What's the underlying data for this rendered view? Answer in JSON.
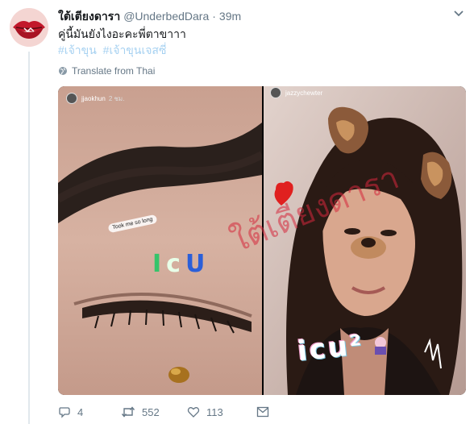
{
  "tweet": {
    "display_name": "ใต้เตียงดารา",
    "handle": "@UnderbedDara",
    "separator": "·",
    "time": "39m",
    "text": "คู่นี้มันยังไงอะคะพี่ตาขาาา",
    "hashtags": [
      "#เจ้าขุน",
      "#เจ้าขุนเจสซี่"
    ],
    "translate_label": "Translate from Thai"
  },
  "media": {
    "left": {
      "username": "jjaokhun",
      "ago": "2 ชม.",
      "caption": "Took me so long",
      "sticker_text": "I c U",
      "sticker_colors": [
        "#35c46a",
        "#ffffff",
        "#2b5fd9"
      ]
    },
    "right": {
      "username": "jazzychewter",
      "ago": "",
      "sticker_text": "icu²"
    },
    "watermark": "ใต้เตียงดารา"
  },
  "actions": {
    "reply_count": "4",
    "retweet_count": "552",
    "like_count": "113"
  },
  "icons": [
    "caret-down-icon",
    "globe-icon",
    "reply-icon",
    "retweet-icon",
    "heart-icon",
    "message-icon"
  ],
  "colors": {
    "hashtag": "#a6d1f1",
    "muted": "#657786",
    "thread_line": "#e1e8ed",
    "watermark": "#d6283c"
  }
}
